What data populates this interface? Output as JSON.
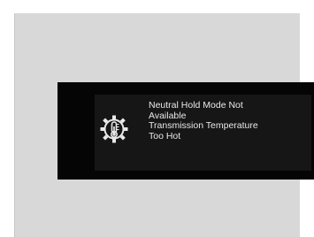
{
  "display": {
    "icon": "transmission-temperature-warning-icon",
    "lines": [
      "Neutral Hold Mode Not",
      "Available",
      "Transmission Temperature",
      "Too Hot"
    ],
    "text_color": "#e9e9e9",
    "screen_color": "#050505",
    "panel_color": "#d8d8d8"
  }
}
